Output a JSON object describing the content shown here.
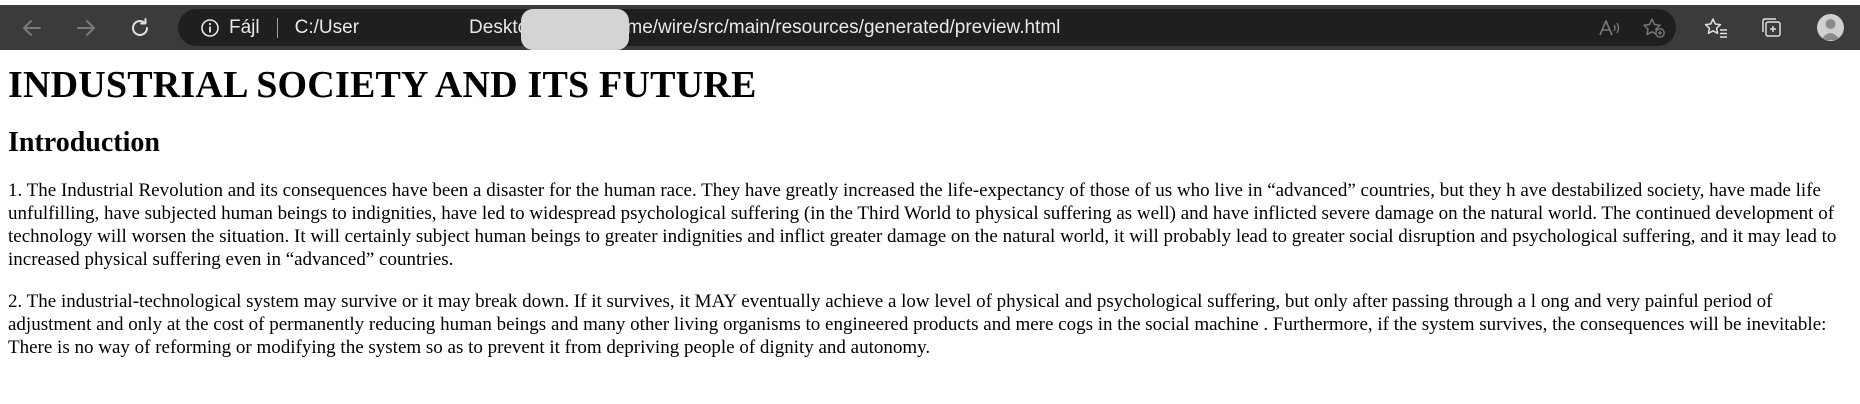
{
  "browser": {
    "site_info_label": "Fájl",
    "url": "C:/Users/Desktop/projects/bme/wire/src/main/resources/generated/preview.html",
    "url_prefix": "C:/User",
    "url_suffix": "Desktop/projects/bme/wire/src/main/resources/generated/preview.html",
    "icons": {
      "back": "back-arrow-icon",
      "forward": "forward-arrow-icon",
      "reload": "reload-icon",
      "site_info": "info-icon",
      "read_aloud": "read-aloud-icon",
      "add_favorite": "add-favorite-icon",
      "favorites": "favorites-icon",
      "collections": "collections-icon",
      "profile": "profile-avatar-icon"
    }
  },
  "document": {
    "title": "INDUSTRIAL SOCIETY AND ITS FUTURE",
    "section_heading": "Introduction",
    "paragraphs": [
      "1. The Industrial Revolution and its consequences have been a disaster for the human race. They have greatly increased the life-expectancy of those of us who live in “advanced” countries, but they h ave destabilized society, have made life unfulfilling, have subjected human beings to indignities, have led to widespread psychological suffering (in the Third World to physical suffering as well) and have inflicted severe damage on the natural world. The continued development of technology will worsen the situation. It will certainly subject human beings to greater indignities and inflict greater damage on the natural world, it will probably lead to greater social disruption and psychological suffering, and it may lead to increased physical suffering even in “advanced” countries.",
      "2. The industrial-technological system may survive or it may break down. If it survives, it MAY eventually achieve a low level of physical and psychological suffering, but only after passing through a l ong and very painful period of adjustment and only at the cost of permanently reducing human beings and many other living organisms to engineered products and mere cogs in the social machine . Furthermore, if the system survives, the consequences will be inevitable: There is no way of reforming or modifying the system so as to prevent it from depriving people of dignity and autonomy."
    ]
  },
  "colors": {
    "toolbar_bg": "#3b3b3b",
    "address_bar_bg": "#1f1f1f",
    "address_text": "#e8e8e8",
    "page_bg": "#ffffff",
    "text": "#000000"
  }
}
